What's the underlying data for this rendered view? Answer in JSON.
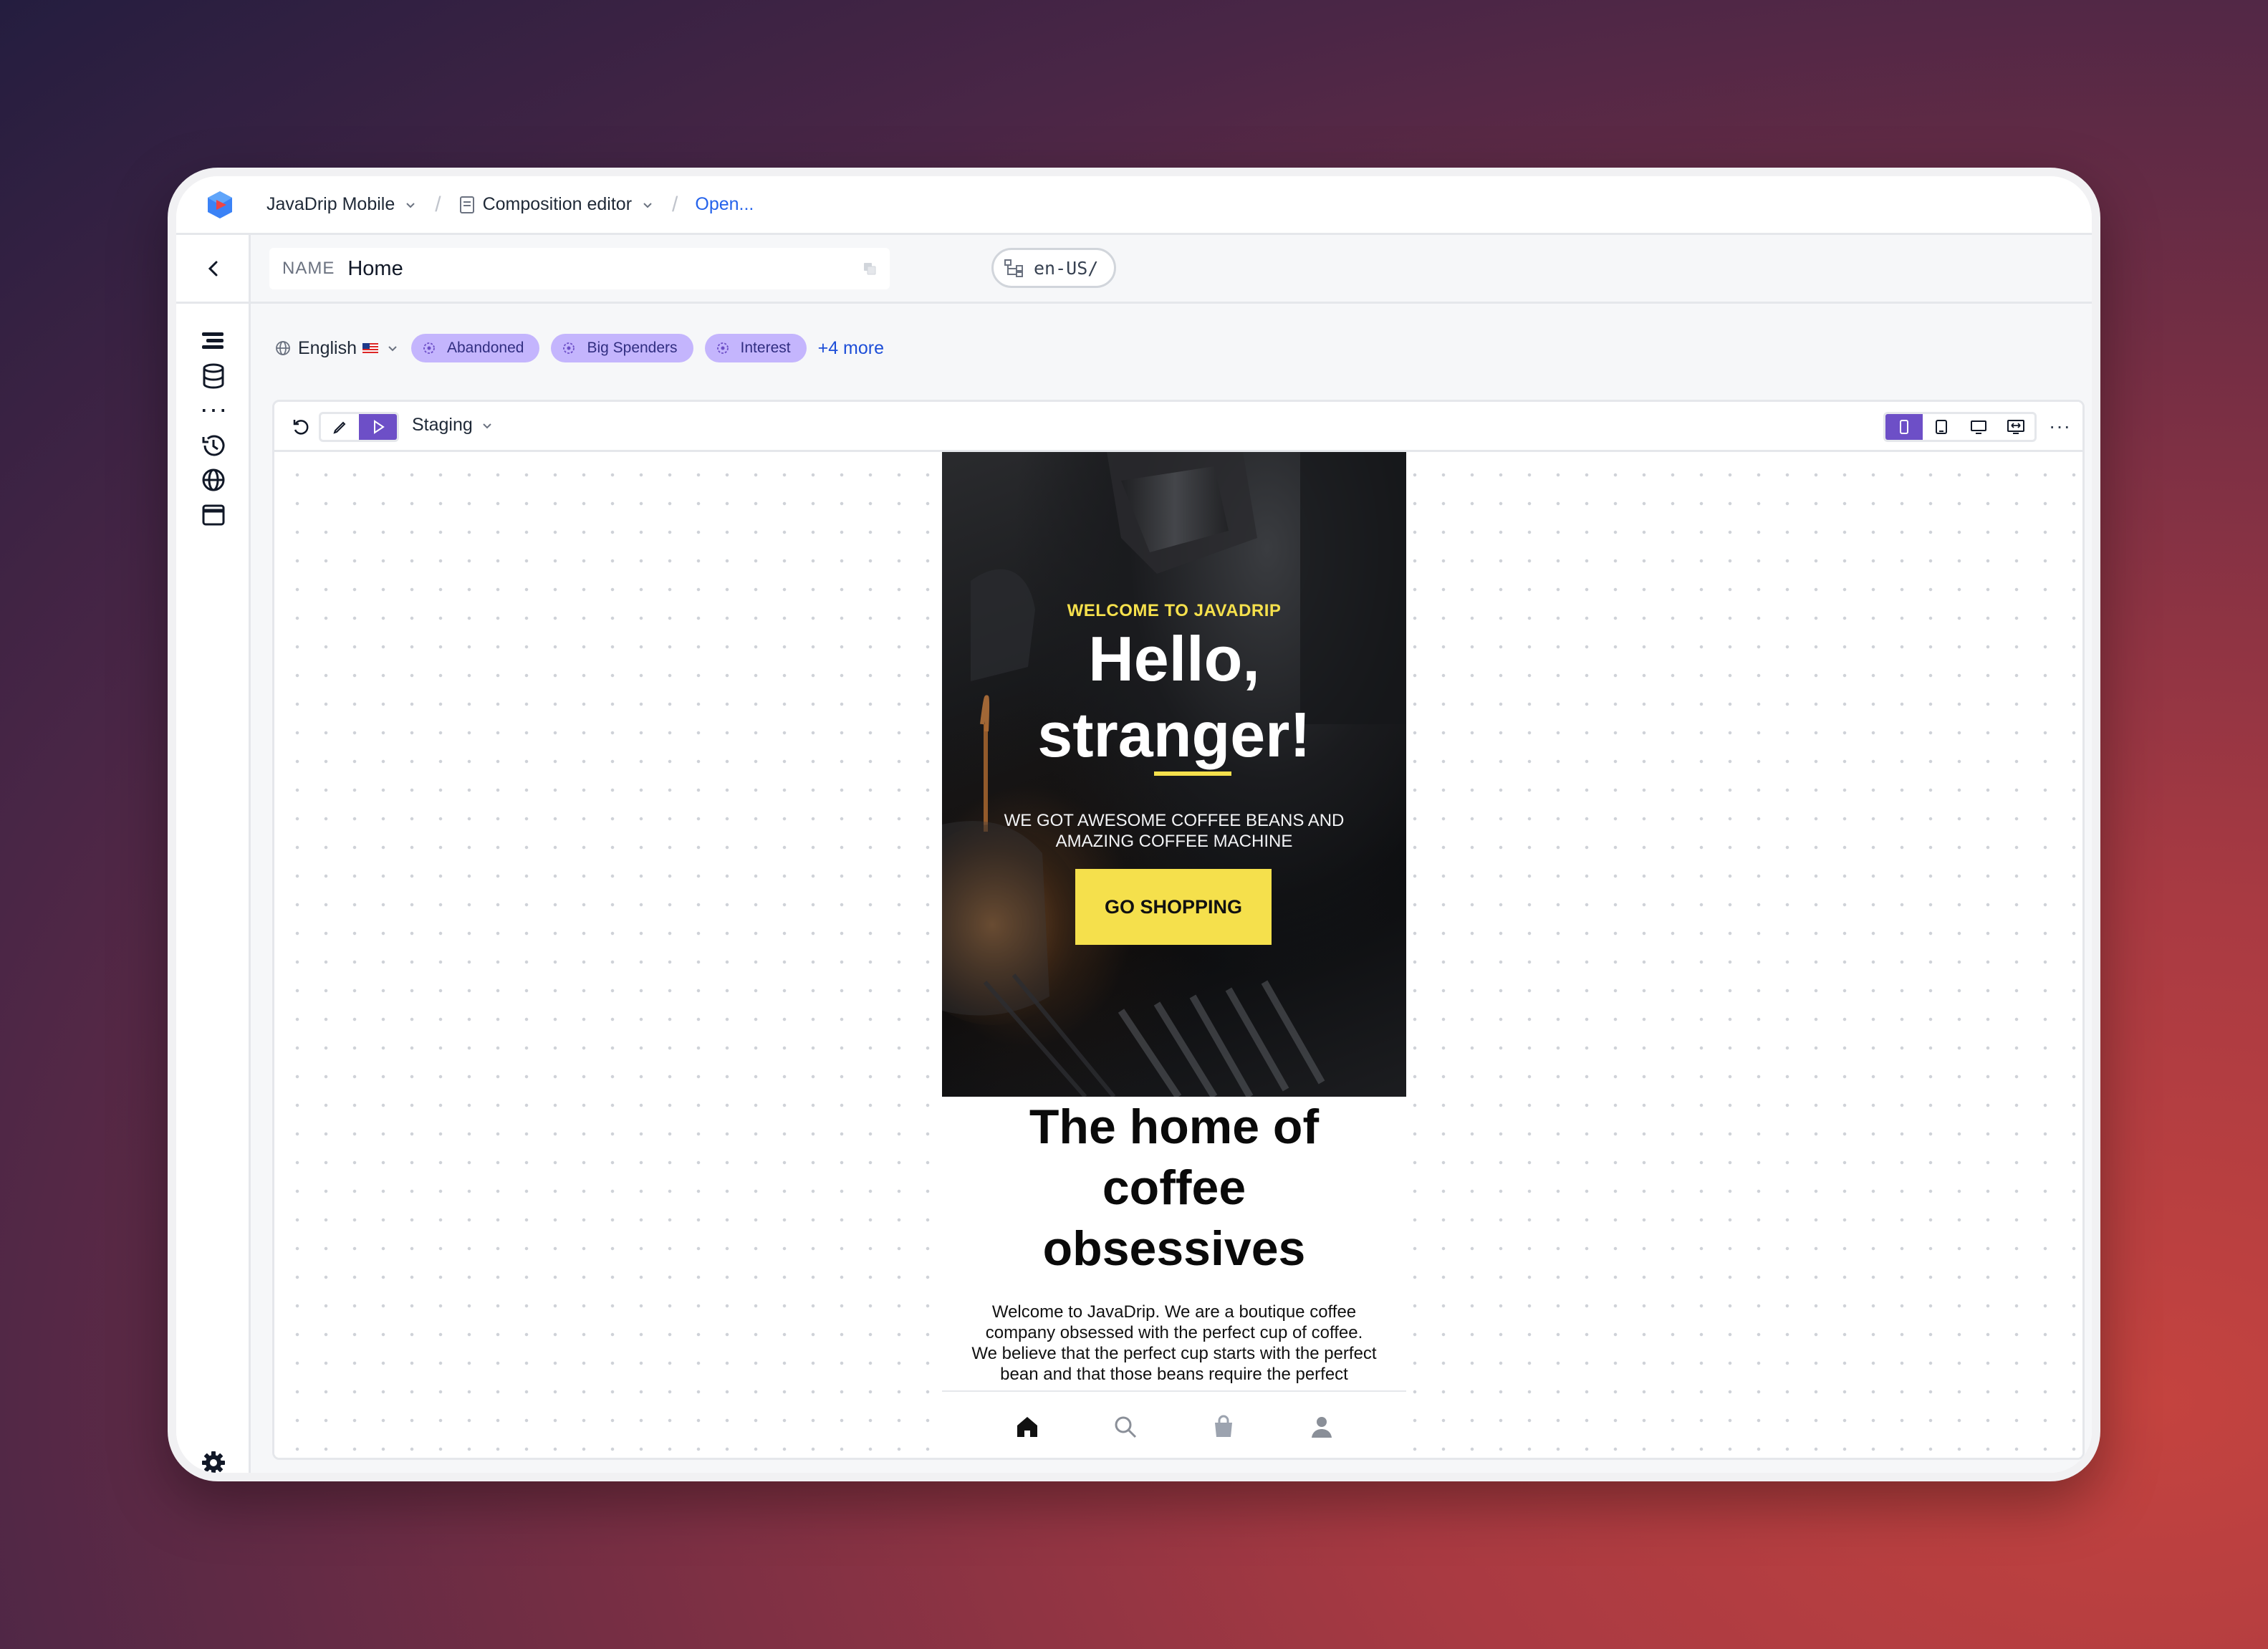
{
  "breadcrumb": {
    "project": "JavaDrip Mobile",
    "editor": "Composition editor",
    "link": "Open..."
  },
  "namebar": {
    "name_label": "NAME",
    "name_value": "Home",
    "path": "en-US/"
  },
  "filters": {
    "locale": "English",
    "chips": [
      "Abandoned",
      "Big Spenders",
      "Interest"
    ],
    "more": "+4 more"
  },
  "toolbar": {
    "environment": "Staging",
    "more": "···"
  },
  "preview": {
    "kicker": "WELCOME TO JAVADRIP",
    "headline_line1": "Hello,",
    "headline_line2": "stranger!",
    "subheading": "WE GOT AWESOME COFFEE BEANS AND AMAZING COFFEE MACHINE",
    "cta": "GO SHOPPING",
    "section_title": "The home of coffee obsessives",
    "body": "Welcome to JavaDrip. We are a boutique coffee company obsessed with the perfect cup of coffee. We believe that the perfect cup starts with the perfect bean and that those beans require the perfect brewing method. This means"
  },
  "colors": {
    "accent": "#6d4fc7",
    "chip": "#c4b5fd",
    "brand_yellow": "#f5e04c",
    "link": "#2563eb"
  },
  "icons": {
    "sidebar": [
      "back-icon",
      "layers-icon",
      "database-icon",
      "braces-icon",
      "history-icon",
      "globe-icon",
      "window-icon",
      "settings-icon"
    ],
    "tabbar": [
      "home-icon",
      "search-icon",
      "bag-icon",
      "user-icon"
    ]
  }
}
